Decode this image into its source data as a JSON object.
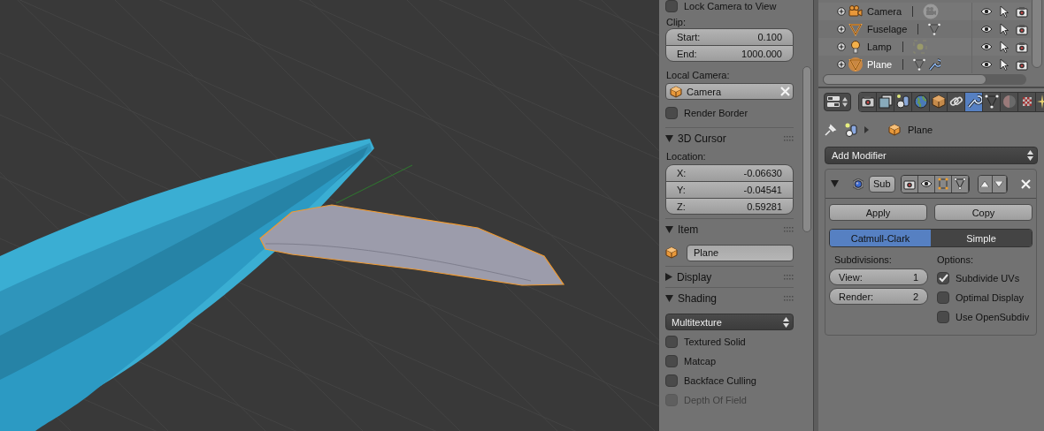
{
  "n_panel": {
    "view": {
      "lock_camera": {
        "label": "Lock Camera to View",
        "checked": false
      },
      "clip_label": "Clip:",
      "clip_fields": [
        {
          "label": "Start:",
          "value": "0.100"
        },
        {
          "label": "End:",
          "value": "1000.000"
        }
      ],
      "local_camera_label": "Local Camera:",
      "local_camera": "Camera",
      "render_border": {
        "label": "Render Border",
        "checked": false
      }
    },
    "cursor_panel": {
      "title": "3D Cursor",
      "expanded": true,
      "location_label": "Location:",
      "fields": [
        {
          "label": "X:",
          "value": "-0.06630"
        },
        {
          "label": "Y:",
          "value": "-0.04541"
        },
        {
          "label": "Z:",
          "value": "0.59281"
        }
      ]
    },
    "item_panel": {
      "title": "Item",
      "expanded": true,
      "name": "Plane"
    },
    "display_panel": {
      "title": "Display",
      "expanded": false
    },
    "shading_panel": {
      "title": "Shading",
      "expanded": true,
      "mode": "Multitexture",
      "options": [
        {
          "label": "Textured Solid",
          "checked": false,
          "disabled": false
        },
        {
          "label": "Matcap",
          "checked": false,
          "disabled": false
        },
        {
          "label": "Backface Culling",
          "checked": false,
          "disabled": false
        },
        {
          "label": "Depth Of Field",
          "checked": false,
          "disabled": true
        }
      ]
    }
  },
  "outliner": {
    "rows": [
      {
        "name": "Camera",
        "kind": "camera",
        "selected": false,
        "modifier": false
      },
      {
        "name": "Fuselage",
        "kind": "mesh",
        "selected": false,
        "modifier": false
      },
      {
        "name": "Lamp",
        "kind": "lamp",
        "selected": false,
        "modifier": false
      },
      {
        "name": "Plane",
        "kind": "mesh",
        "selected": true,
        "modifier": true
      }
    ]
  },
  "properties": {
    "tabs": [
      {
        "kind": "render",
        "selected": false
      },
      {
        "kind": "render_layers",
        "selected": false
      },
      {
        "kind": "scene",
        "selected": false
      },
      {
        "kind": "world",
        "selected": false
      },
      {
        "kind": "object",
        "selected": false
      },
      {
        "kind": "constraints",
        "selected": false
      },
      {
        "kind": "modifiers",
        "selected": true
      },
      {
        "kind": "data",
        "selected": false
      },
      {
        "kind": "material",
        "selected": false
      },
      {
        "kind": "texture",
        "selected": false
      },
      {
        "kind": "particles",
        "selected": false
      }
    ],
    "breadcrumb": "Plane",
    "add_modifier": "Add Modifier",
    "modifier": {
      "expanded": true,
      "name": "Sub",
      "apply": "Apply",
      "copy": "Copy",
      "types": [
        {
          "label": "Catmull-Clark",
          "selected": true
        },
        {
          "label": "Simple",
          "selected": false
        }
      ],
      "subdivisions_label": "Subdivisions:",
      "levels": [
        {
          "label": "View:",
          "value": "1"
        },
        {
          "label": "Render:",
          "value": "2"
        }
      ],
      "options_label": "Options:",
      "options": [
        {
          "label": "Subdivide UVs",
          "checked": true
        },
        {
          "label": "Optimal Display",
          "checked": false
        },
        {
          "label": "Use OpenSubdiv",
          "checked": false
        }
      ]
    }
  }
}
